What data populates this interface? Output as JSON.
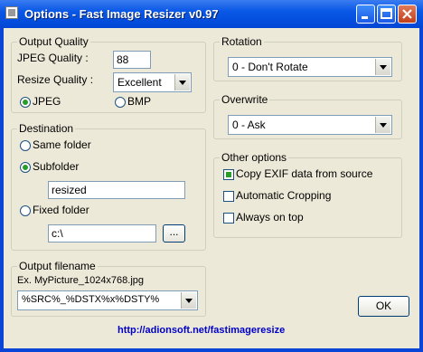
{
  "window": {
    "title": "Options - Fast Image Resizer v0.97"
  },
  "output_quality": {
    "legend": "Output Quality",
    "jpeg_quality_label": "JPEG Quality :",
    "jpeg_quality_value": "88",
    "resize_quality_label": "Resize Quality :",
    "resize_quality_value": "Excellent",
    "format_jpeg": "JPEG",
    "format_bmp": "BMP",
    "selected_format": "JPEG"
  },
  "destination": {
    "legend": "Destination",
    "same_folder": "Same folder",
    "subfolder": "Subfolder",
    "subfolder_value": "resized",
    "fixed_folder": "Fixed folder",
    "fixed_folder_value": "c:\\",
    "browse_label": "..."
  },
  "output_filename": {
    "legend": "Output filename",
    "example": "Ex. MyPicture_1024x768.jpg",
    "pattern": "%SRC%_%DSTX%x%DSTY%"
  },
  "rotation": {
    "legend": "Rotation",
    "value": "0 - Don't Rotate"
  },
  "overwrite": {
    "legend": "Overwrite",
    "value": "0 - Ask"
  },
  "other_options": {
    "legend": "Other options",
    "copy_exif": "Copy EXIF data from source",
    "auto_crop": "Automatic Cropping",
    "always_on_top": "Always on top"
  },
  "ok_label": "OK",
  "url": "http://adionsoft.net/fastimageresize"
}
